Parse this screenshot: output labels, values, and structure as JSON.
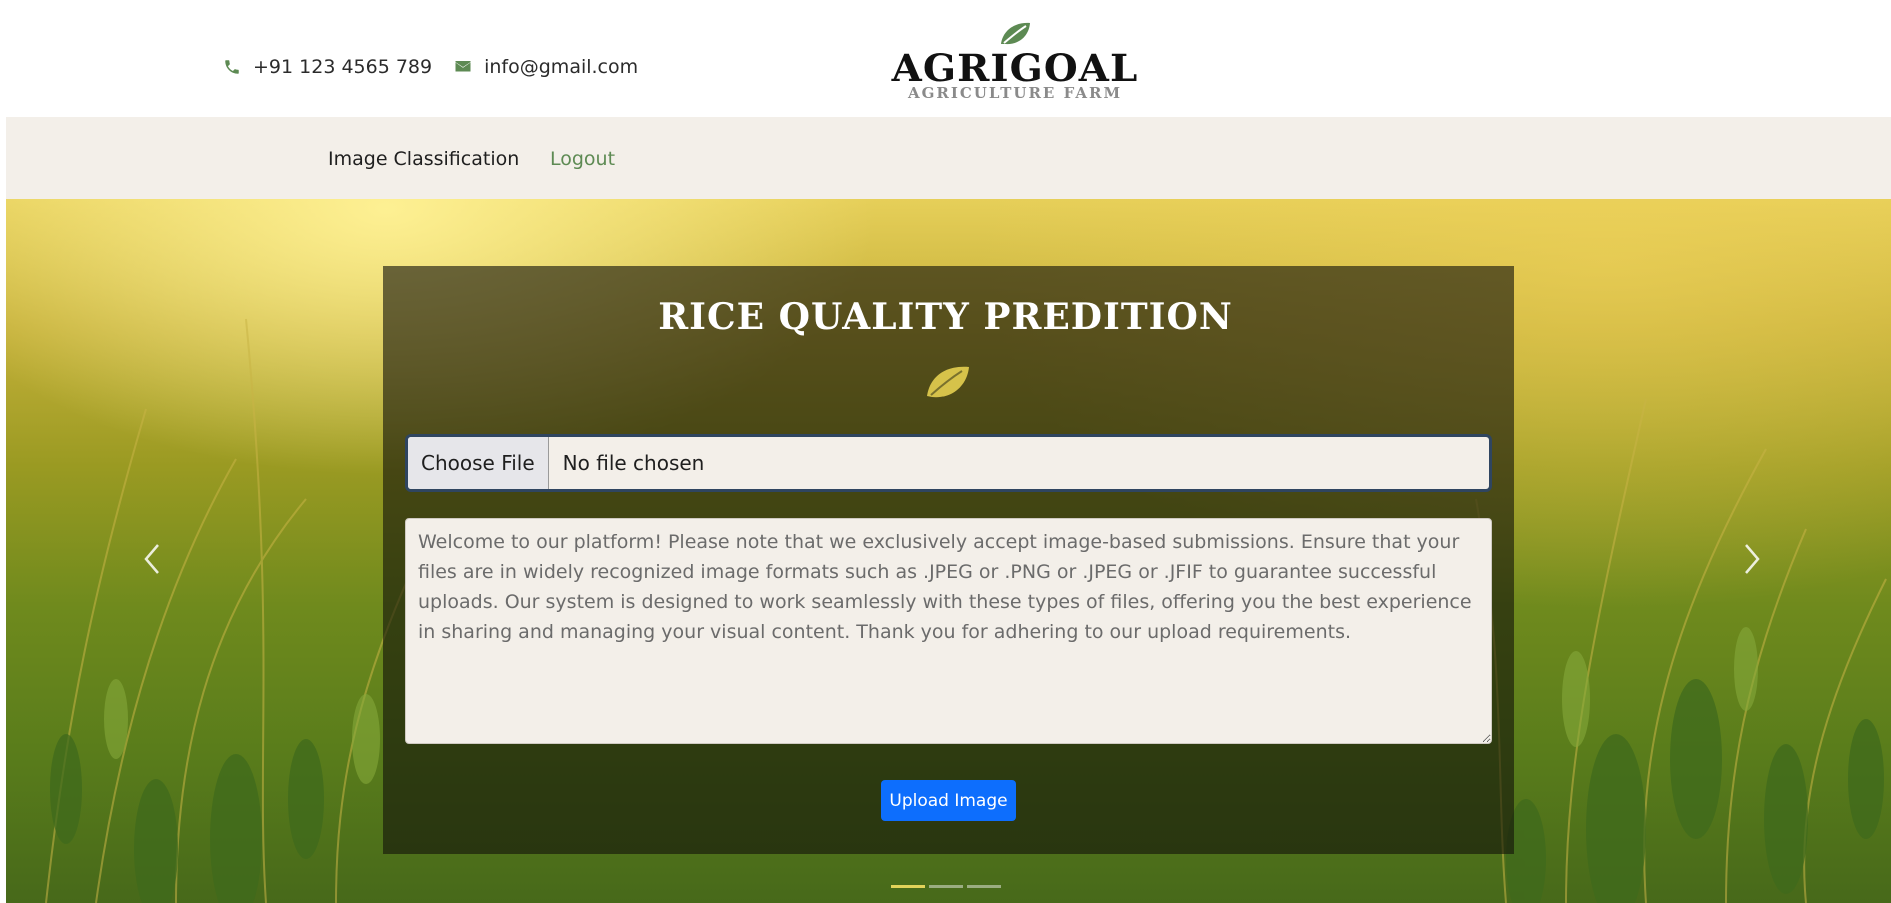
{
  "header": {
    "phone": "+91 123 4565 789",
    "email": "info@gmail.com",
    "brand_name": "AGRIGOAL",
    "brand_tagline": "AGRICULTURE FARM"
  },
  "nav": {
    "items": [
      {
        "label": "Image Classification"
      },
      {
        "label": "Logout"
      }
    ]
  },
  "hero": {
    "title": "RICE QUALITY PREDITION",
    "file_input": {
      "button_label": "Choose File",
      "status": "No file chosen"
    },
    "notice_text": "Welcome to our platform! Please note that we exclusively accept image-based submissions. Ensure that your files are in widely recognized image formats such as .JPEG or .PNG or .JPEG or .JFIF to guarantee successful uploads. Our system is designed to work seamlessly with these types of files, offering you the best experience in sharing and managing your visual content. Thank you for adhering to our upload requirements.",
    "upload_label": "Upload Image",
    "carousel": {
      "slides": 3,
      "active_slide": 1
    }
  },
  "icons": {
    "phone": "phone-icon",
    "email": "envelope-icon",
    "logo": "leaf-icon",
    "panel": "leaf-icon",
    "prev": "chevron-left-icon",
    "next": "chevron-right-icon"
  },
  "colors": {
    "accent_green": "#5d8a53",
    "nav_background": "#f3efe9",
    "upload_button": "#0d6efd",
    "panel_leaf": "#d6c24a"
  }
}
